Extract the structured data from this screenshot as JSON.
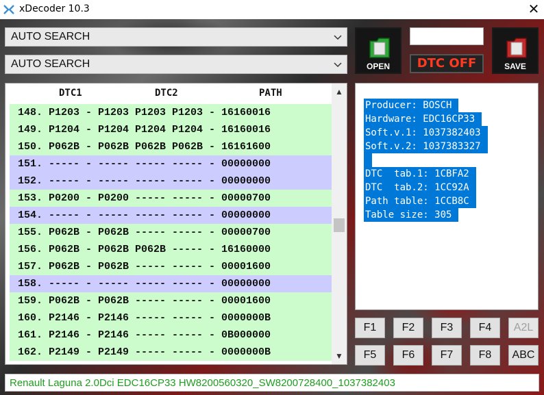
{
  "window": {
    "title": "xDecoder 10.3"
  },
  "combos": {
    "first": "AUTO SEARCH",
    "second": "AUTO SEARCH"
  },
  "buttons": {
    "open": "OPEN",
    "dtc_off": "DTC OFF",
    "save": "SAVE"
  },
  "table": {
    "headers": {
      "dtc1": "DTC1",
      "dtc2": "DTC2",
      "path": "PATH"
    },
    "rows": [
      {
        "text": "148. P1203 - P1203 P1203 P1203 - 16160016",
        "kind": "green"
      },
      {
        "text": "149. P1204 - P1204 P1204 P1204 - 16160016",
        "kind": "green"
      },
      {
        "text": "150. P062B - P062B P062B P062B - 16161600",
        "kind": "green"
      },
      {
        "text": "151. ----- - ----- ----- ----- - 00000000",
        "kind": "blue"
      },
      {
        "text": "152. ----- - ----- ----- ----- - 00000000",
        "kind": "blue"
      },
      {
        "text": "153. P0200 - P0200 ----- ----- - 00000700",
        "kind": "green"
      },
      {
        "text": "154. ----- - ----- ----- ----- - 00000000",
        "kind": "blue"
      },
      {
        "text": "155. P062B - P062B ----- ----- - 00000700",
        "kind": "green"
      },
      {
        "text": "156. P062B - P062B P062B ----- - 16160000",
        "kind": "green"
      },
      {
        "text": "157. P062B - P062B ----- ----- - 00001600",
        "kind": "green"
      },
      {
        "text": "158. ----- - ----- ----- ----- - 00000000",
        "kind": "blue"
      },
      {
        "text": "159. P062B - P062B ----- ----- - 00001600",
        "kind": "green"
      },
      {
        "text": "160. P2146 - P2146 ----- ----- - 0000000B",
        "kind": "green"
      },
      {
        "text": "161. P2146 - P2146 ----- ----- - 0B000000",
        "kind": "green"
      },
      {
        "text": "162. P2149 - P2149 ----- ----- - 0000000B",
        "kind": "green"
      }
    ]
  },
  "info": {
    "lines": [
      "Producer: BOSCH",
      "Hardware: EDC16CP33",
      "Soft.v.1: 1037382403",
      "Soft.v.2: 1037383327",
      "",
      "DTC  tab.1: 1CBFA2",
      "DTC  tab.2: 1CC92A",
      "Path table: 1CCB8C",
      "Table size: 305"
    ]
  },
  "function_keys": {
    "row1": [
      "F1",
      "F2",
      "F3",
      "F4",
      "A2L"
    ],
    "row2": [
      "F5",
      "F6",
      "F7",
      "F8",
      "ABC"
    ]
  },
  "status": {
    "text": "Renault Laguna 2.0Dci EDC16CP33 HW8200560320_SW8200728400_1037382403"
  },
  "colors": {
    "row_green": "#ccfccc",
    "row_blue": "#ccccff",
    "selection": "#0078d7",
    "status_text": "#1f9d1f",
    "dtc_off": "#ff3a22"
  }
}
